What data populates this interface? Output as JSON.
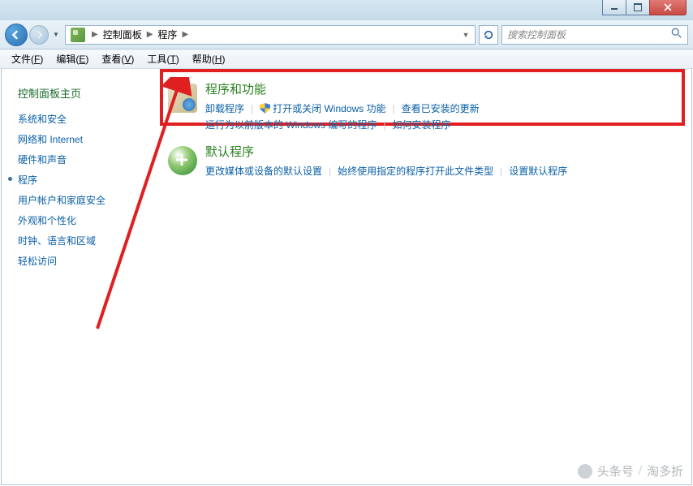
{
  "window_controls": {
    "minimize": "min",
    "maximize": "max",
    "close": "close"
  },
  "nav": {
    "breadcrumb": [
      "控制面板",
      "程序"
    ],
    "search_placeholder": "搜索控制面板"
  },
  "menubar": [
    {
      "label": "文件",
      "key": "F"
    },
    {
      "label": "编辑",
      "key": "E"
    },
    {
      "label": "查看",
      "key": "V"
    },
    {
      "label": "工具",
      "key": "T"
    },
    {
      "label": "帮助",
      "key": "H"
    }
  ],
  "sidebar": {
    "title": "控制面板主页",
    "items": [
      {
        "label": "系统和安全"
      },
      {
        "label": "网络和 Internet"
      },
      {
        "label": "硬件和声音"
      },
      {
        "label": "程序",
        "current": true
      },
      {
        "label": "用户帐户和家庭安全"
      },
      {
        "label": "外观和个性化"
      },
      {
        "label": "时钟、语言和区域"
      },
      {
        "label": "轻松访问"
      }
    ]
  },
  "sections": [
    {
      "title": "程序和功能",
      "links_row1": [
        {
          "text": "卸载程序",
          "shield": false
        },
        {
          "text": "打开或关闭 Windows 功能",
          "shield": true
        },
        {
          "text": "查看已安装的更新",
          "shield": false
        }
      ],
      "links_row2": [
        {
          "text": "运行为以前版本的 Windows 编写的程序",
          "shield": false
        },
        {
          "text": "如何安装程序",
          "shield": false
        }
      ]
    },
    {
      "title": "默认程序",
      "links_row1": [
        {
          "text": "更改媒体或设备的默认设置",
          "shield": false
        },
        {
          "text": "始终使用指定的程序打开此文件类型",
          "shield": false
        },
        {
          "text": "设置默认程序",
          "shield": false
        }
      ],
      "links_row2": []
    }
  ],
  "watermark": {
    "prefix": "头条号",
    "name": "淘多折"
  }
}
